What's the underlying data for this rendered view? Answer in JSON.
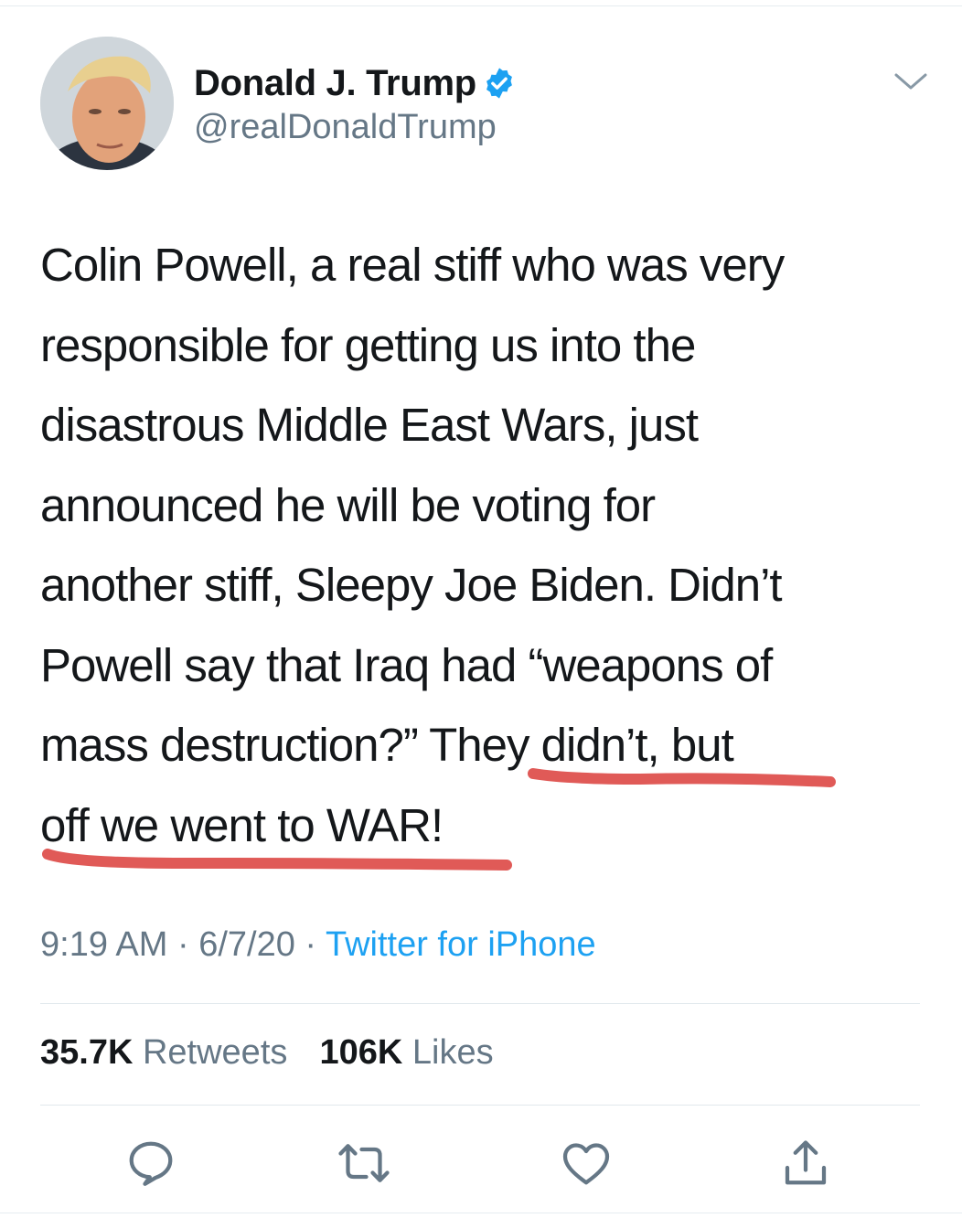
{
  "author": {
    "display_name": "Donald J. Trump",
    "handle": "@realDonaldTrump",
    "verified": true
  },
  "tweet": {
    "lines": [
      "Colin Powell, a real stiff who was very",
      "responsible for getting us into the",
      "disastrous Middle East Wars, just",
      "announced he will be voting for",
      "another stiff, Sleepy Joe Biden. Didn’t",
      "Powell say that Iraq had “weapons of",
      "mass destruction?” They didn’t, but",
      "off we went to WAR!"
    ]
  },
  "meta": {
    "time": "9:19 AM",
    "sep1": " · ",
    "date": "6/7/20",
    "sep2": " · ",
    "source": "Twitter for iPhone"
  },
  "stats": {
    "retweets_count": "35.7K",
    "retweets_label": "Retweets",
    "likes_count": "106K",
    "likes_label": "Likes"
  },
  "icons": {
    "verified": "verified-badge-icon",
    "more": "chevron-down-icon",
    "reply": "reply-icon",
    "retweet": "retweet-icon",
    "like": "heart-icon",
    "share": "share-icon"
  },
  "colors": {
    "accent": "#1da1f2",
    "secondary_text": "#657786",
    "annotation": "#e05a57"
  }
}
